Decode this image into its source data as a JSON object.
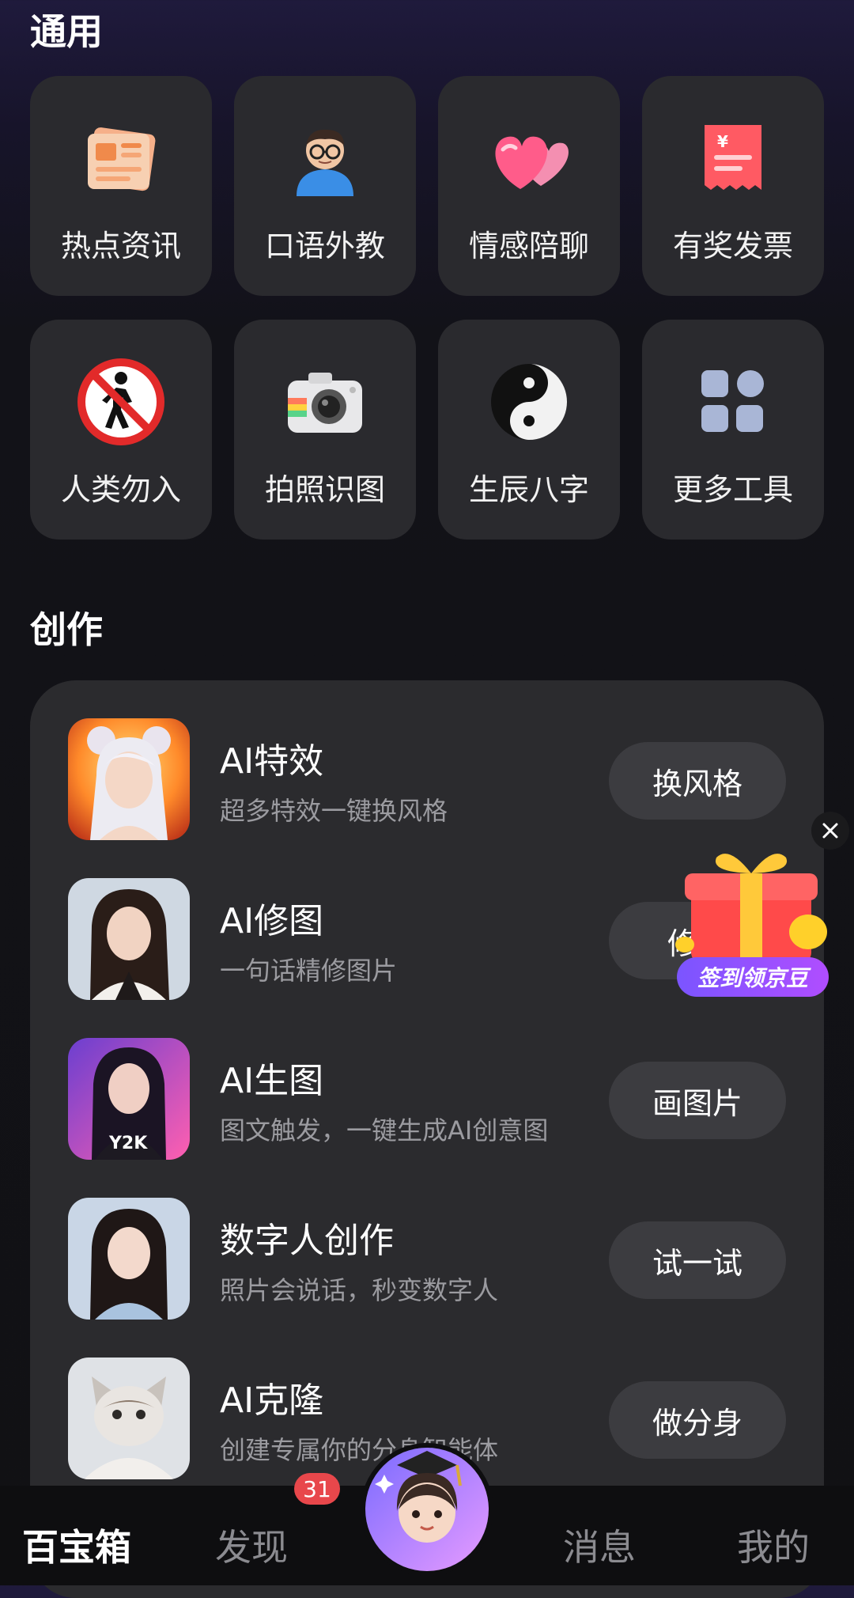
{
  "sections": {
    "general_title": "通用",
    "create_title": "创作"
  },
  "tools": [
    {
      "label": "热点资讯",
      "icon": "newspaper-icon"
    },
    {
      "label": "口语外教",
      "icon": "teacher-avatar-icon"
    },
    {
      "label": "情感陪聊",
      "icon": "hearts-icon"
    },
    {
      "label": "有奖发票",
      "icon": "invoice-icon"
    },
    {
      "label": "人类勿入",
      "icon": "no-pedestrian-icon"
    },
    {
      "label": "拍照识图",
      "icon": "camera-icon"
    },
    {
      "label": "生辰八字",
      "icon": "yin-yang-icon"
    },
    {
      "label": "更多工具",
      "icon": "grid-apps-icon"
    }
  ],
  "creations": [
    {
      "title": "AI特效",
      "desc": "超多特效一键换风格",
      "button": "换风格"
    },
    {
      "title": "AI修图",
      "desc": "一句话精修图片",
      "button": "修图"
    },
    {
      "title": "AI生图",
      "desc": "图文触发，一键生成AI创意图",
      "button": "画图片"
    },
    {
      "title": "数字人创作",
      "desc": "照片会说话，秒变数字人",
      "button": "试一试"
    },
    {
      "title": "AI克隆",
      "desc": "创建专属你的分身智能体",
      "button": "做分身"
    }
  ],
  "promo": {
    "label": "签到领京豆",
    "icon": "gift-box-icon",
    "close_icon": "close-icon"
  },
  "nav": {
    "tab1": "百宝箱",
    "tab2": "发现",
    "tab2_badge": "31",
    "tab3": "消息",
    "tab4": "我的",
    "center_icon": "assistant-avatar-icon"
  },
  "colors": {
    "accent_badge": "#e8474b",
    "promo_purple": "#8a4dff"
  }
}
